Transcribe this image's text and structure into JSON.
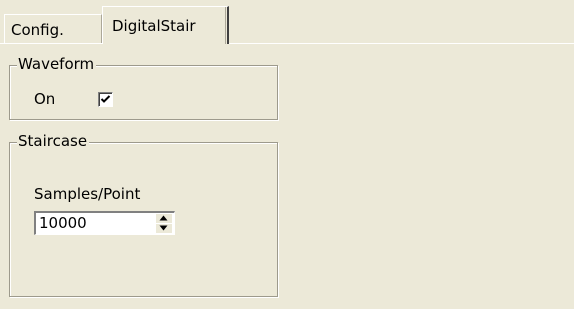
{
  "tabs": [
    {
      "label": "Config.",
      "selected": false
    },
    {
      "label": "DigitalStair",
      "selected": true
    }
  ],
  "waveform": {
    "legend": "Waveform",
    "on_label": "On",
    "on_checked": true
  },
  "staircase": {
    "legend": "Staircase",
    "samples_label": "Samples/Point",
    "samples_value": "10000"
  },
  "icons": {
    "checkmark": "checkmark-icon",
    "spin_up": "spin-up-arrow-icon",
    "spin_down": "spin-down-arrow-icon"
  },
  "colors": {
    "window_bg": "#ece9d8",
    "groupbox_border": "#9d9a8c",
    "field_bg": "#ffffff"
  }
}
